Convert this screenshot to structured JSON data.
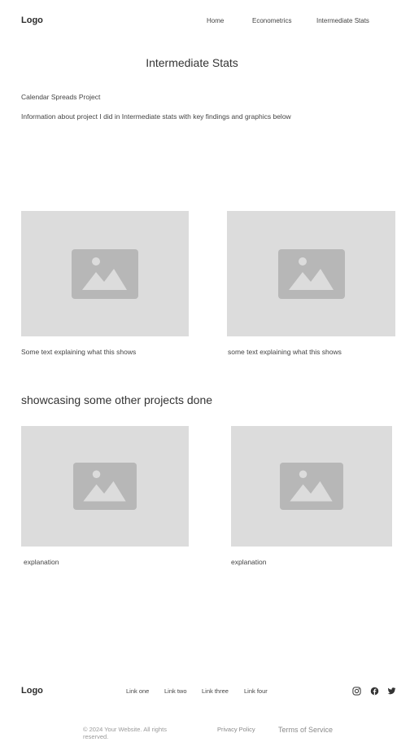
{
  "header": {
    "logo": "Logo",
    "nav": [
      {
        "label": "Home"
      },
      {
        "label": "Econometrics"
      },
      {
        "label": "Intermediate Stats"
      }
    ]
  },
  "main": {
    "title": "Intermediate Stats",
    "project_name": "Calendar Spreads Project",
    "project_description": "Information about project I did in Intermediate stats with key findings and graphics below",
    "figures": [
      {
        "icon": "image-placeholder-icon",
        "caption": "Some text explaining what this shows"
      },
      {
        "icon": "image-placeholder-icon",
        "caption": "some text explaining what this shows"
      }
    ],
    "other_projects_title": "showcasing some other projects done",
    "other_projects": [
      {
        "icon": "image-placeholder-icon",
        "caption": "explanation"
      },
      {
        "icon": "image-placeholder-icon",
        "caption": "explanation"
      }
    ]
  },
  "footer": {
    "logo": "Logo",
    "links": [
      {
        "label": "Link one"
      },
      {
        "label": "Link two"
      },
      {
        "label": "Link three"
      },
      {
        "label": "Link four"
      }
    ],
    "social": [
      {
        "icon": "instagram-icon"
      },
      {
        "icon": "facebook-icon"
      },
      {
        "icon": "twitter-icon"
      }
    ],
    "copyright": "© 2024 Your Website. All rights reserved.",
    "privacy": "Privacy Policy",
    "terms": "Terms of Service"
  },
  "colors": {
    "placeholder_bg": "#dcdcdc",
    "placeholder_icon": "#b7b7b7",
    "text": "#333333",
    "muted": "#9a9a9a"
  }
}
